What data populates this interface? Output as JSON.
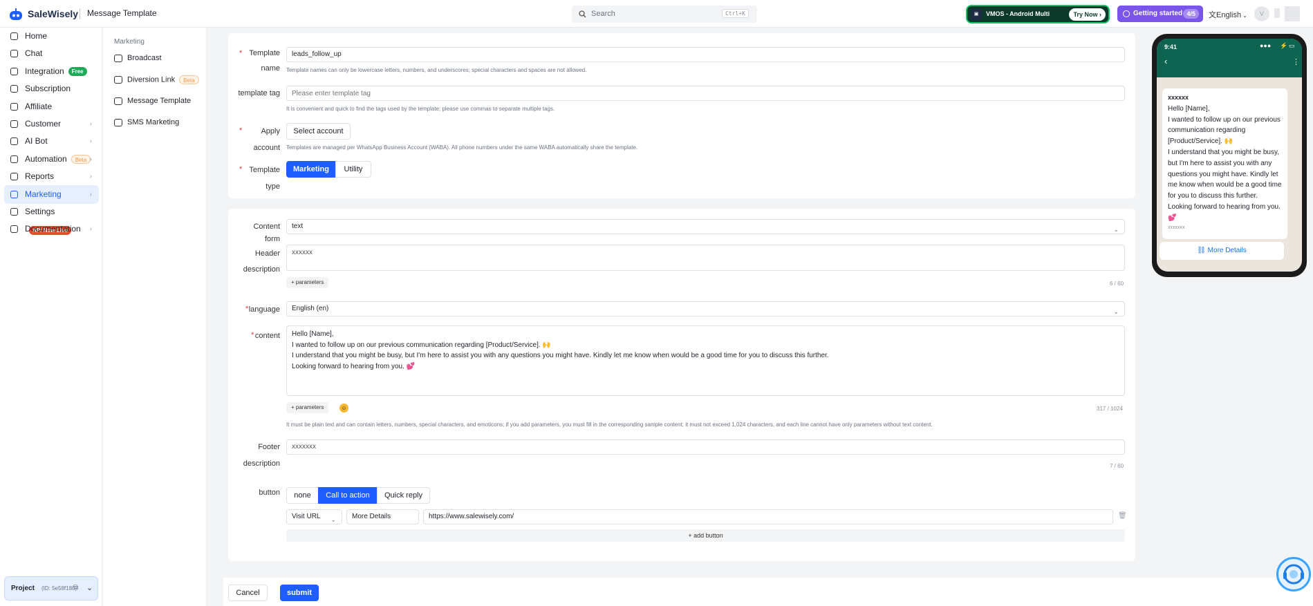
{
  "header": {
    "brand": "SaleWisely",
    "title": "Message Template",
    "search_placeholder": "Search",
    "search_shortcut": "Ctrl+K",
    "promo_title": "VMOS - Android Multi",
    "promo_cta": "Try Now",
    "getting_started": "Getting started",
    "getting_started_count": "4/5",
    "language": "English",
    "avatar_initial": "V"
  },
  "nav": {
    "items": [
      {
        "label": "Home",
        "icon": "home-icon"
      },
      {
        "label": "Chat",
        "icon": "chat-icon"
      },
      {
        "label": "Integration",
        "icon": "integration-icon",
        "badge": "Free"
      },
      {
        "label": "Subscription",
        "icon": "subscription-icon"
      },
      {
        "label": "Affiliate",
        "icon": "affiliate-icon"
      },
      {
        "label": "Customer",
        "icon": "customer-icon",
        "chevron": true
      },
      {
        "label": "AI Bot",
        "icon": "ai-bot-icon",
        "chevron": true
      },
      {
        "label": "Automation",
        "icon": "automation-icon",
        "badge": "Beta",
        "chevron": true
      },
      {
        "label": "Reports",
        "icon": "reports-icon",
        "chevron": true
      },
      {
        "label": "Marketing",
        "icon": "marketing-icon",
        "chevron": true,
        "active": true
      },
      {
        "label": "Settings",
        "icon": "settings-icon",
        "badge": "API Now Live"
      },
      {
        "label": "Documentation",
        "icon": "documentation-icon",
        "chevron": true
      }
    ],
    "project_label": "Project",
    "project_id": "(ID: 5e58f180)"
  },
  "subnav": {
    "heading": "Marketing",
    "items": [
      {
        "label": "Broadcast",
        "icon": "broadcast-icon"
      },
      {
        "label": "Diversion Link",
        "icon": "share-icon",
        "badge": "Beta"
      },
      {
        "label": "Message Template",
        "icon": "template-icon"
      },
      {
        "label": "SMS Marketing",
        "icon": "mail-icon"
      }
    ]
  },
  "form": {
    "template_name_label_1": "Template",
    "template_name_label_2": "name",
    "template_name_value": "leads_follow_up",
    "template_name_hint": "Template names can only be lowercase letters, numbers, and underscores; special characters and spaces are not allowed.",
    "template_tag_label": "template tag",
    "template_tag_placeholder": "Please enter template tag",
    "template_tag_hint": "It is convenient and quick to find the tags used by the template; please use commas to separate multiple tags.",
    "apply_label_1": "Apply",
    "apply_label_2": "account",
    "apply_button": "Select account",
    "apply_hint": "Templates are managed per WhatsApp Business Account (WABA). All phone numbers under the same WABA automatically share the template.",
    "type_label_1": "Template",
    "type_label_2": "type",
    "type_options": [
      "Marketing",
      "Utility"
    ],
    "content_form_label_1": "Content",
    "content_form_label_2": "form",
    "content_form_value": "text",
    "header_label_1": "Header",
    "header_label_2": "description",
    "header_value": "xxxxxx",
    "header_params": "+ parameters",
    "header_count": "6 / 60",
    "language_label": "language",
    "language_value": "English (en)",
    "content_label": "content",
    "content_lines": [
      "Hello [Name],",
      "I wanted to follow up on our previous communication regarding [Product/Service]. 🙌",
      "I understand that you might be busy, but I'm here to assist you with any questions you might have. Kindly let me know when would be a good time for you to discuss this further.",
      "Looking forward to hearing from you. 💕"
    ],
    "content_params": "+ parameters",
    "content_count": "317 / 1024",
    "content_hint": "It must be plain text and can contain letters, numbers, special characters, and emoticons; if you add parameters, you must fill in the corresponding sample content; it must not exceed 1,024 characters, and each line cannot have only parameters without text content.",
    "footer_label_1": "Footer",
    "footer_label_2": "description",
    "footer_value": "xxxxxxx",
    "footer_count": "7 / 60",
    "button_label": "button",
    "button_options": [
      "none",
      "Call to action",
      "Quick reply"
    ],
    "cta_type": "Visit URL",
    "cta_text": "More Details",
    "cta_url": "https://www.salewisely.com/",
    "add_button": "+ add button",
    "cancel": "Cancel",
    "submit": "submit"
  },
  "preview": {
    "time": "9:41",
    "header": "xxxxxx",
    "body_lines": [
      "Hello [Name],",
      "I wanted to follow up on our previous",
      "communication regarding",
      "[Product/Service]. 🙌",
      "I understand that you might be busy,",
      "but I'm here to assist you with any",
      "questions you might have. Kindly let",
      "me know when would be a good time",
      "for you to discuss this further.",
      "Looking forward to hearing from you.",
      "💕"
    ],
    "footer": "xxxxxxx",
    "button": "More Details"
  },
  "colors": {
    "primary": "#1e5eff",
    "purple": "#7b55e9",
    "whatsapp_green": "#0d6450"
  }
}
